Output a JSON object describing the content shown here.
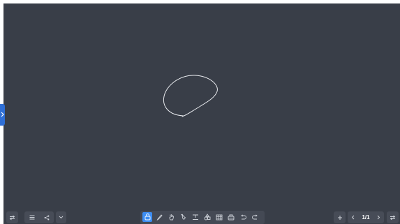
{
  "board": {
    "background_color": "#393e48",
    "stroke_color": "#e8eaee"
  },
  "left_controls": {
    "items": [
      {
        "icon": "swap-icon"
      },
      {
        "icon": "menu-icon"
      },
      {
        "icon": "share-icon"
      },
      {
        "icon": "chevron-down-icon"
      }
    ]
  },
  "toolbar": {
    "tools": [
      {
        "icon": "select-icon",
        "active": true
      },
      {
        "icon": "pen-icon"
      },
      {
        "icon": "hand-icon"
      },
      {
        "icon": "laser-icon"
      },
      {
        "icon": "text-icon"
      },
      {
        "icon": "shapes-icon"
      },
      {
        "icon": "table-icon"
      },
      {
        "icon": "eraser-icon"
      },
      {
        "icon": "undo-icon"
      },
      {
        "icon": "redo-icon"
      }
    ],
    "accent_color": "#3d8df2"
  },
  "right_controls": {
    "add_page_icon": "plus-icon",
    "prev_icon": "chevron-left-icon",
    "page_indicator": "1/1",
    "next_icon": "chevron-right-icon",
    "swap_icon": "swap-icon"
  }
}
